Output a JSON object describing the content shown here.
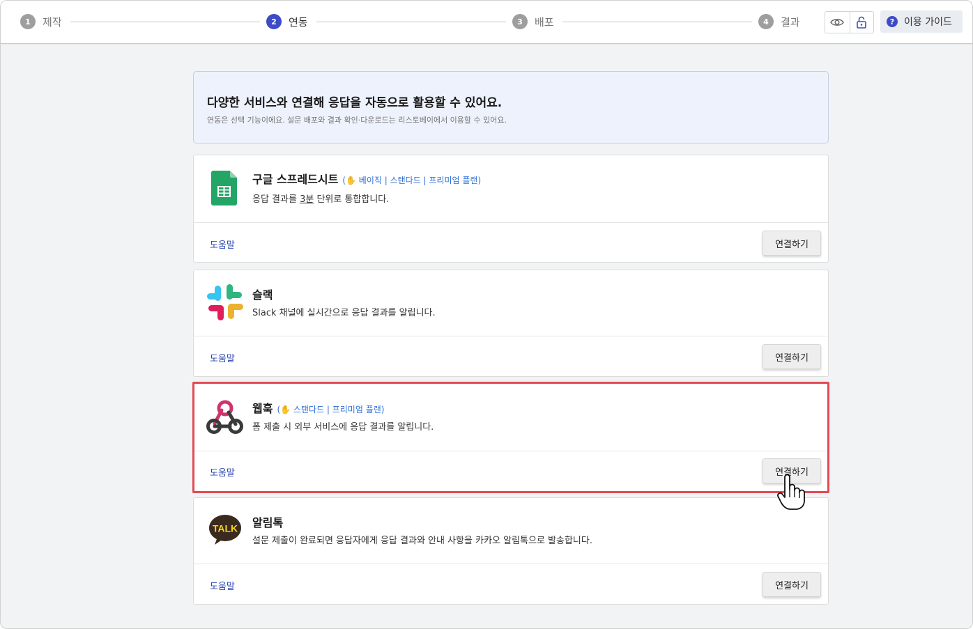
{
  "stepper": {
    "steps": [
      {
        "num": "1",
        "label": "제작"
      },
      {
        "num": "2",
        "label": "연동"
      },
      {
        "num": "3",
        "label": "배포"
      },
      {
        "num": "4",
        "label": "결과"
      }
    ],
    "active_step": "2",
    "preview_icon": "eye-icon",
    "lock_icon": "lock-icon",
    "guide_label": "이용 가이드"
  },
  "banner": {
    "title": "다양한 서비스와 연결해 응답을 자동으로 활용할 수 있어요.",
    "subtitle": "연동은 선택 기능이에요. 설문 배포와 결과 확인·다운로드는 리스토베이에서 이용할 수 있어요."
  },
  "integrations": [
    {
      "id": "google-sheets",
      "name": "구글 스프레드시트",
      "plan": "(✋ 베이직 | 스탠다드 | 프리미엄 플랜)",
      "desc_before": "응답 결과를 ",
      "desc_underline": "3분",
      "desc_after": " 단위로 통합합니다.",
      "help": "도움말",
      "connect": "연결하기",
      "icon": "google-sheets-icon"
    },
    {
      "id": "slack",
      "name": "슬랙",
      "plan": "",
      "desc": "Slack 채널에 실시간으로 응답 결과를 알립니다.",
      "help": "도움말",
      "connect": "연결하기",
      "icon": "slack-icon"
    },
    {
      "id": "webhook",
      "name": "웹훅",
      "plan": "(✋ 스탠다드 | 프리미엄 플랜)",
      "desc": "폼 제출 시 외부 서비스에 응답 결과를 알립니다.",
      "help": "도움말",
      "connect": "연결하기",
      "icon": "webhook-icon"
    },
    {
      "id": "alimtalk",
      "name": "알림톡",
      "plan": "",
      "desc": "설문 제출이 완료되면 응답자에게 응답 결과와 안내 사항을 카카오 알림톡으로 발송합니다.",
      "help": "도움말",
      "connect": "연결하기",
      "icon": "kakao-talk-icon",
      "logo_text": "TALK"
    }
  ],
  "colors": {
    "accent": "#3d4cc5",
    "highlight": "#e34a55",
    "link": "#2d47b4"
  }
}
